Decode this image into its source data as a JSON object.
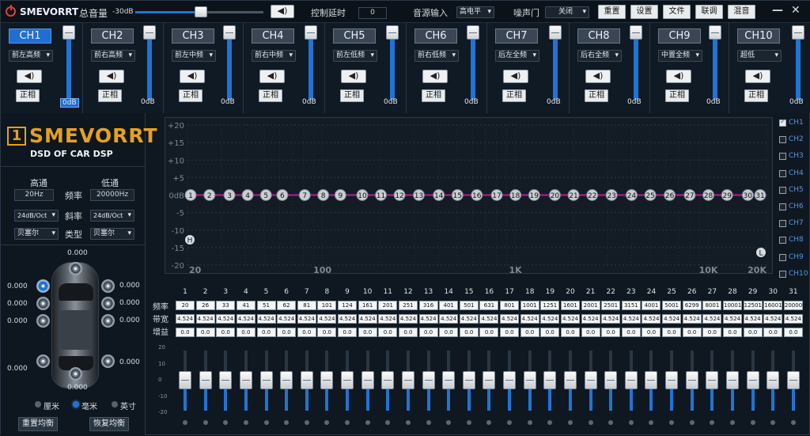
{
  "titlebar": {
    "app": "SMEVORRT",
    "master_label": "总音量",
    "master_value": "-30dB",
    "delay_label": "控制延时",
    "delay_value": "0",
    "src_label": "音源输入",
    "src_value": "高电平",
    "noise_label": "噪声门",
    "noise_value": "关闭",
    "buttons": [
      "重置",
      "设置",
      "文件",
      "联调",
      "混音"
    ],
    "min": "—",
    "close": "✕",
    "spk": "◀)"
  },
  "channels": [
    {
      "label": "CH1",
      "pos": "前左高频",
      "mute": "◀)",
      "phase": "正相",
      "gain": "0dB",
      "active": true
    },
    {
      "label": "CH2",
      "pos": "前右高频",
      "mute": "◀)",
      "phase": "正相",
      "gain": "0dB"
    },
    {
      "label": "CH3",
      "pos": "前左中频",
      "mute": "◀)",
      "phase": "正相",
      "gain": "0dB"
    },
    {
      "label": "CH4",
      "pos": "前右中频",
      "mute": "◀)",
      "phase": "正相",
      "gain": "0dB"
    },
    {
      "label": "CH5",
      "pos": "前左低频",
      "mute": "◀)",
      "phase": "正相",
      "gain": "0dB"
    },
    {
      "label": "CH6",
      "pos": "前右低频",
      "mute": "◀)",
      "phase": "正相",
      "gain": "0dB"
    },
    {
      "label": "CH7",
      "pos": "后左全频",
      "mute": "◀)",
      "phase": "正相",
      "gain": "0dB"
    },
    {
      "label": "CH8",
      "pos": "后右全频",
      "mute": "◀)",
      "phase": "正相",
      "gain": "0dB"
    },
    {
      "label": "CH9",
      "pos": "中置全频",
      "mute": "◀)",
      "phase": "正相",
      "gain": "0dB"
    },
    {
      "label": "CH10",
      "pos": "超低",
      "mute": "◀)",
      "phase": "正相",
      "gain": "0dB"
    }
  ],
  "brand": {
    "logo_num": "1",
    "name": "SMEVORRT",
    "tagline": "DSD OF CAR DSP"
  },
  "xover": {
    "hp_label": "高通",
    "lp_label": "低通",
    "freq_label": "频率",
    "slope_label": "斜率",
    "type_label": "类型",
    "hp_freq": "20Hz",
    "lp_freq": "20000Hz",
    "hp_slope": "24dB/Oct",
    "lp_slope": "24dB/Oct",
    "hp_type": "贝塞尔",
    "lp_type": "贝塞尔"
  },
  "car": {
    "top": "0.000",
    "left1": "0.000",
    "left2": "0.000",
    "left3": "0.000",
    "left4": "0.000",
    "right1": "0.000",
    "right2": "0.000",
    "right3": "0.000",
    "right4": "0.000",
    "bottom": "0.000",
    "units": [
      "厘米",
      "毫米",
      "英寸"
    ],
    "selected_unit": "毫米",
    "reset": "重置均衡",
    "restore": "恢复均衡"
  },
  "eq_graph": {
    "y_ticks": [
      "+20",
      "+15",
      "+10",
      "+5",
      "0dB",
      "-5",
      "-10",
      "-15",
      "-20"
    ],
    "x_ticks": [
      "20",
      "100",
      "1K",
      "10K",
      "20K"
    ],
    "markers": [
      "1",
      "2",
      "3",
      "4",
      "5",
      "6",
      "7",
      "8",
      "9",
      "10",
      "11",
      "12",
      "13",
      "14",
      "15",
      "16",
      "17",
      "18",
      "19",
      "20",
      "21",
      "22",
      "23",
      "24",
      "25",
      "26",
      "27",
      "28",
      "29",
      "30",
      "31"
    ],
    "end_left": "H",
    "end_right": "L",
    "accent": "#c0169f"
  },
  "channel_select": [
    {
      "label": "CH1",
      "on": true
    },
    {
      "label": "CH2"
    },
    {
      "label": "CH3"
    },
    {
      "label": "CH4"
    },
    {
      "label": "CH5"
    },
    {
      "label": "CH6"
    },
    {
      "label": "CH7"
    },
    {
      "label": "CH8"
    },
    {
      "label": "CH9"
    },
    {
      "label": "CH10"
    }
  ],
  "bands": {
    "row_labels": [
      "频率",
      "带宽",
      "增益"
    ],
    "numbers": [
      "1",
      "2",
      "3",
      "4",
      "5",
      "6",
      "7",
      "8",
      "9",
      "10",
      "11",
      "12",
      "13",
      "14",
      "15",
      "16",
      "17",
      "18",
      "19",
      "20",
      "21",
      "22",
      "23",
      "24",
      "25",
      "26",
      "27",
      "28",
      "29",
      "30",
      "31"
    ],
    "freq": [
      "20",
      "26",
      "33",
      "41",
      "51",
      "62",
      "81",
      "101",
      "124",
      "161",
      "201",
      "251",
      "316",
      "401",
      "501",
      "631",
      "801",
      "1001",
      "1251",
      "1601",
      "2001",
      "2501",
      "3151",
      "4001",
      "5001",
      "6299",
      "8001",
      "10001",
      "12501",
      "16001",
      "20000"
    ],
    "bw": "4.524",
    "gain": "0.0",
    "scale": [
      "20",
      "10",
      "0",
      "-10",
      "-20"
    ]
  }
}
